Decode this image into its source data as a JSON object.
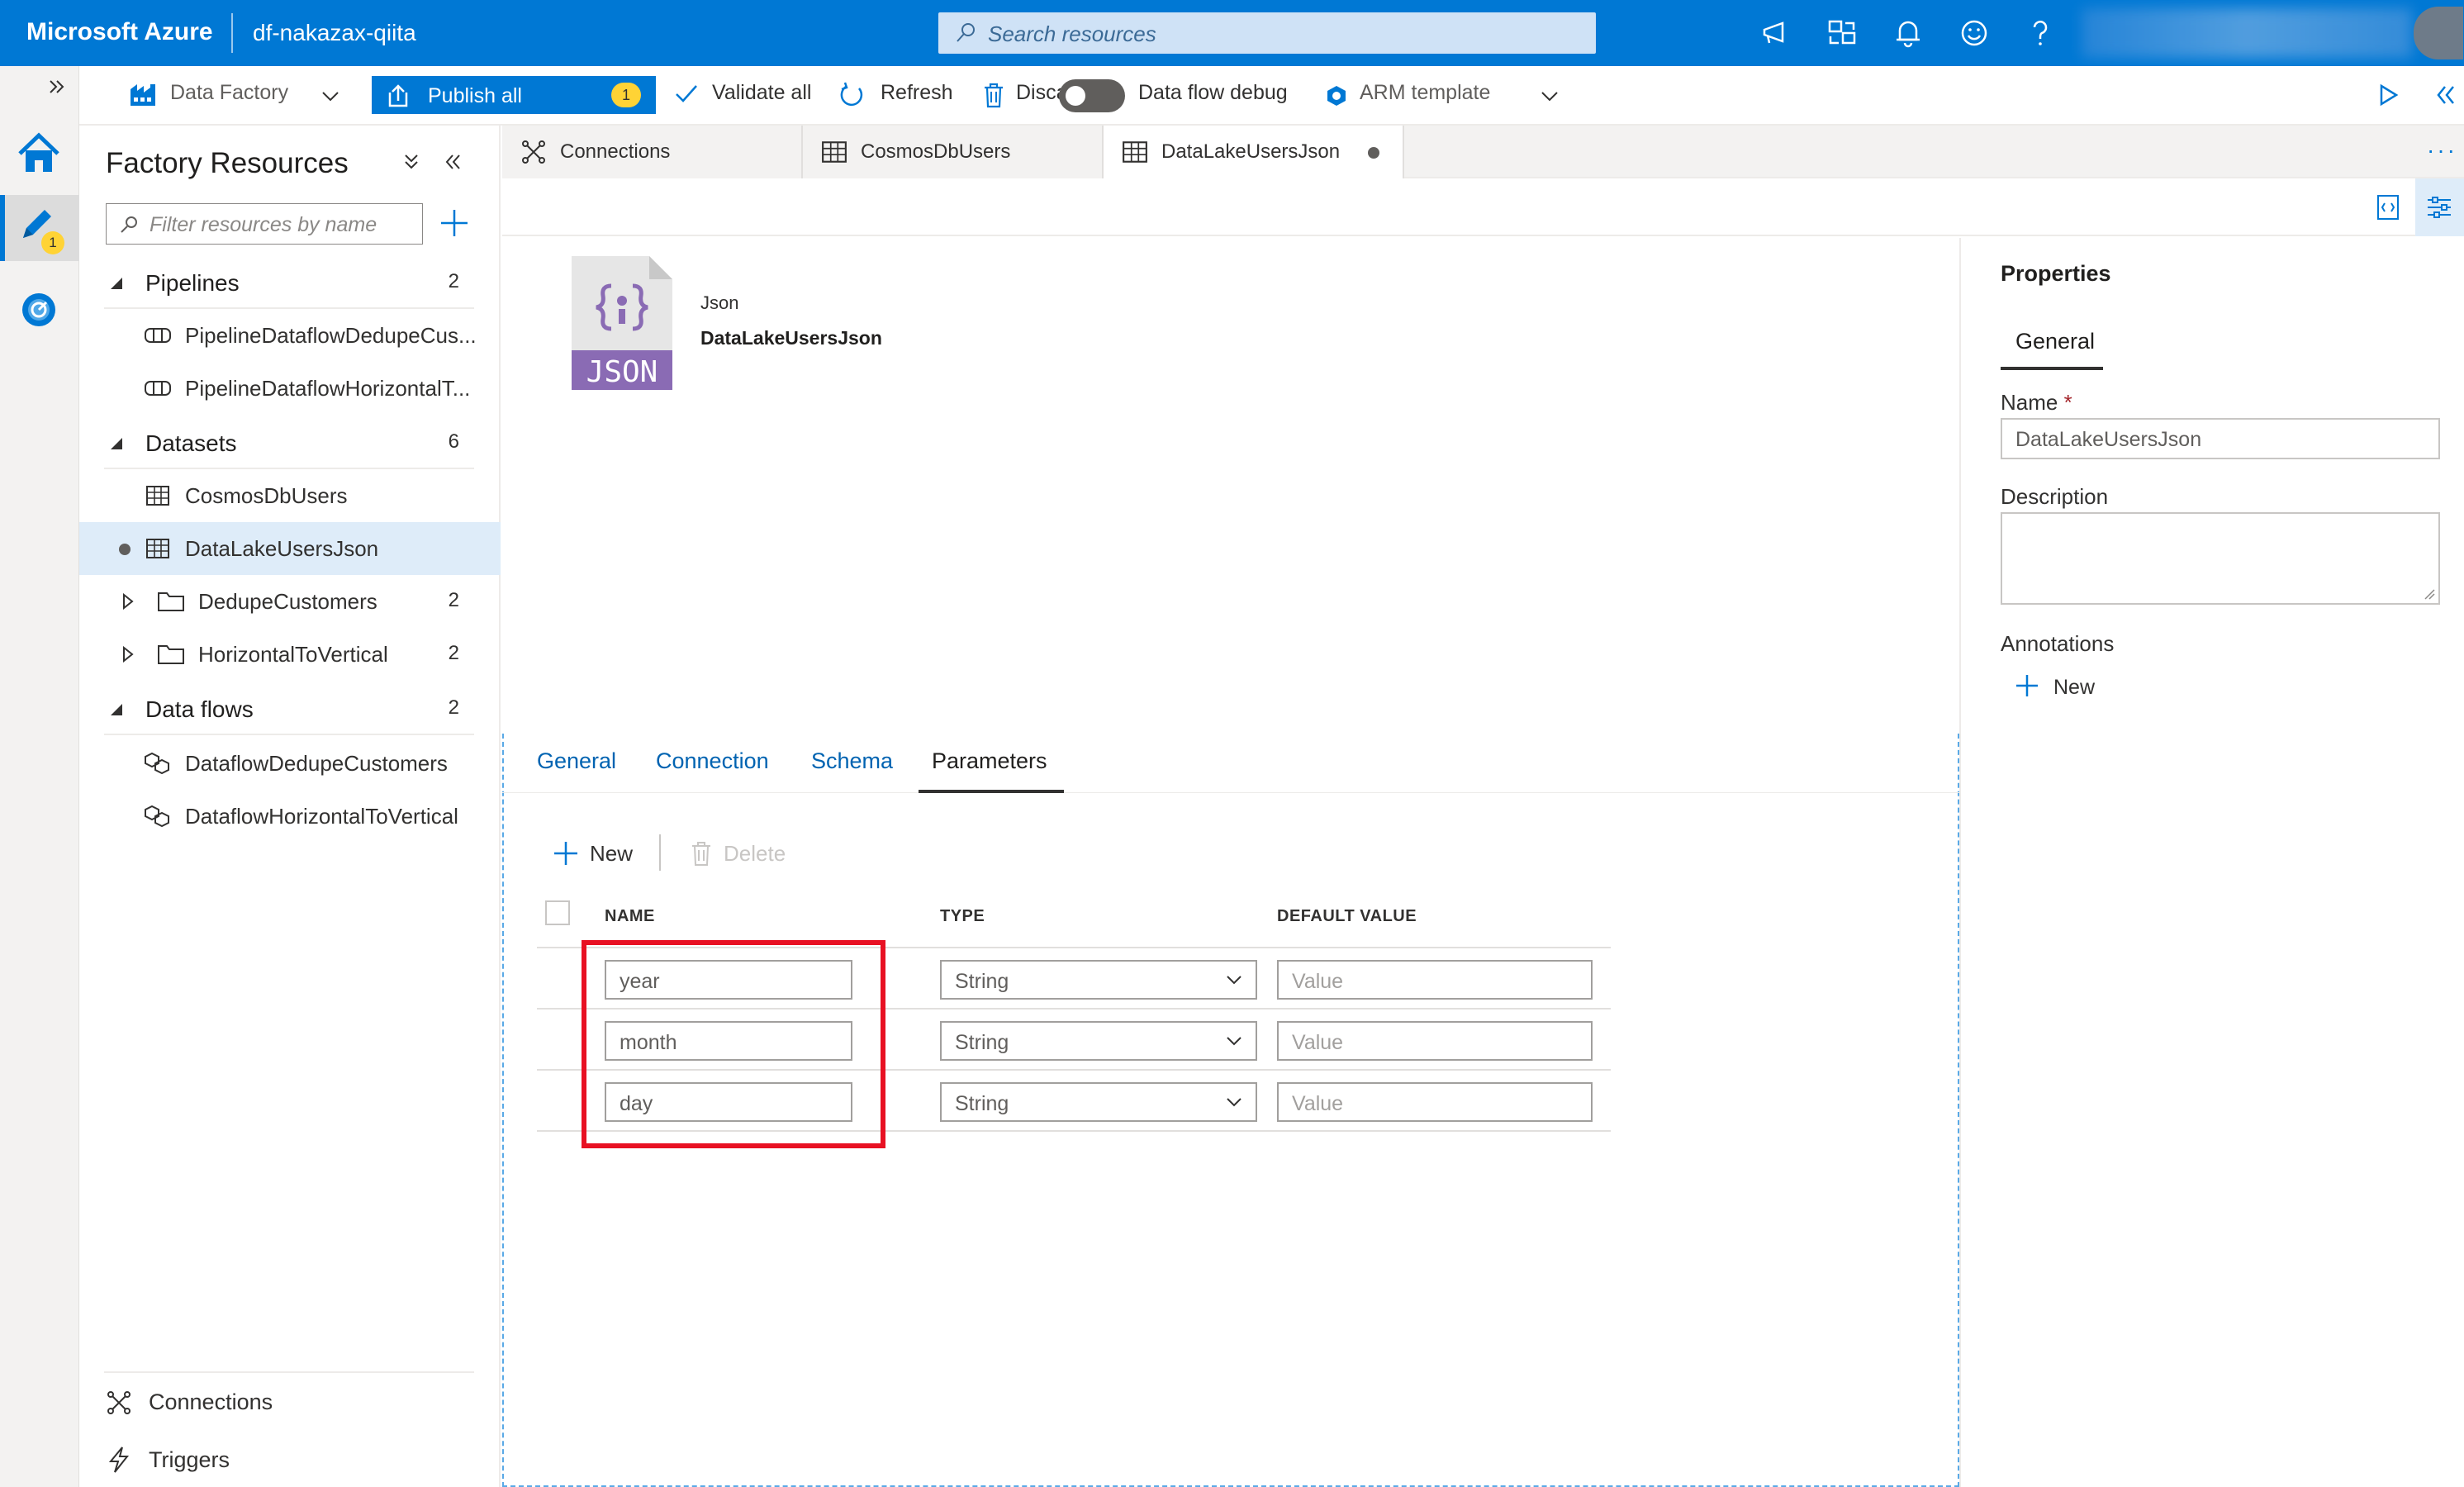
{
  "header": {
    "brand": "Microsoft Azure",
    "factory_name": "df-nakazax-qiita",
    "search_placeholder": "Search resources"
  },
  "toolbar": {
    "data_factory_label": "Data Factory",
    "publish_label": "Publish all",
    "publish_badge": "1",
    "validate_label": "Validate all",
    "refresh_label": "Refresh",
    "discard_label": "Discard all",
    "debug_label": "Data flow debug",
    "arm_label": "ARM template"
  },
  "rail": {
    "author_badge": "1"
  },
  "resources": {
    "title": "Factory Resources",
    "filter_placeholder": "Filter resources by name",
    "pipelines": {
      "label": "Pipelines",
      "count": "2",
      "items": [
        "PipelineDataflowDedupeCus...",
        "PipelineDataflowHorizontalT..."
      ]
    },
    "datasets": {
      "label": "Datasets",
      "count": "6",
      "items": [
        "CosmosDbUsers",
        "DataLakeUsersJson"
      ],
      "folders": [
        {
          "label": "DedupeCustomers",
          "count": "2"
        },
        {
          "label": "HorizontalToVertical",
          "count": "2"
        }
      ]
    },
    "dataflows": {
      "label": "Data flows",
      "count": "2",
      "items": [
        "DataflowDedupeCustomers",
        "DataflowHorizontalToVertical"
      ]
    },
    "bottom": [
      "Connections",
      "Triggers"
    ]
  },
  "tabs": [
    "Connections",
    "CosmosDbUsers",
    "DataLakeUsersJson"
  ],
  "dataset": {
    "icon_text": "JSON",
    "type": "Json",
    "name": "DataLakeUsersJson"
  },
  "pane_tabs": [
    "General",
    "Connection",
    "Schema",
    "Parameters"
  ],
  "params": {
    "new_label": "New",
    "delete_label": "Delete",
    "columns": [
      "NAME",
      "TYPE",
      "DEFAULT VALUE"
    ],
    "rows": [
      {
        "name": "year",
        "type": "String",
        "default_placeholder": "Value"
      },
      {
        "name": "month",
        "type": "String",
        "default_placeholder": "Value"
      },
      {
        "name": "day",
        "type": "String",
        "default_placeholder": "Value"
      }
    ]
  },
  "properties": {
    "title": "Properties",
    "tab": "General",
    "name_label": "Name",
    "required_mark": "*",
    "name_value": "DataLakeUsersJson",
    "description_label": "Description",
    "annotations_label": "Annotations",
    "new_label": "New"
  },
  "colors": {
    "azure_blue": "#0078d4",
    "highlight_red": "#e81123",
    "json_purple": "#8a6bb4"
  }
}
